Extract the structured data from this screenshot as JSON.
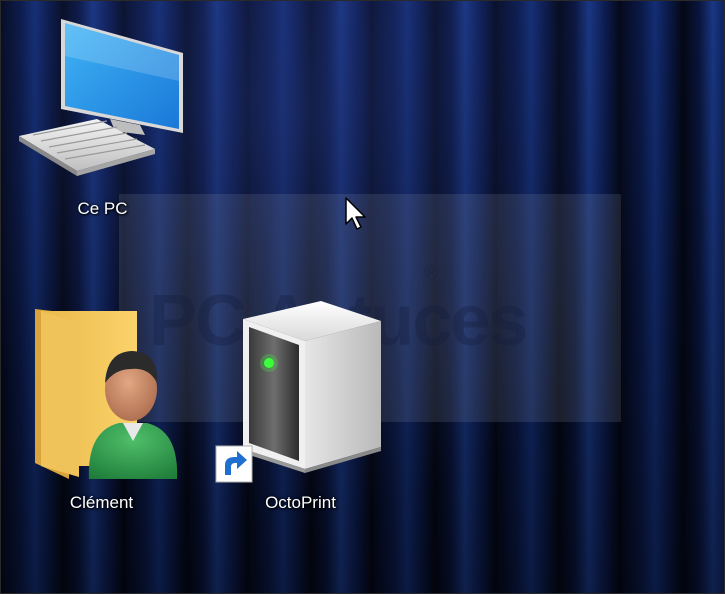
{
  "desktop": {
    "icons": [
      {
        "label": "Ce PC",
        "icon": "monitor-pc-icon"
      },
      {
        "label": "Clément",
        "icon": "user-folder-icon"
      },
      {
        "label": "OctoPrint",
        "icon": "server-tower-icon",
        "overlay": "shortcut-arrow-icon"
      }
    ],
    "watermark": {
      "text": "PC Astuces",
      "mark": "®"
    }
  },
  "colors": {
    "wallpaper_light": "#1a3a8a",
    "wallpaper_dark": "#040816",
    "label_text": "#ffffff"
  }
}
